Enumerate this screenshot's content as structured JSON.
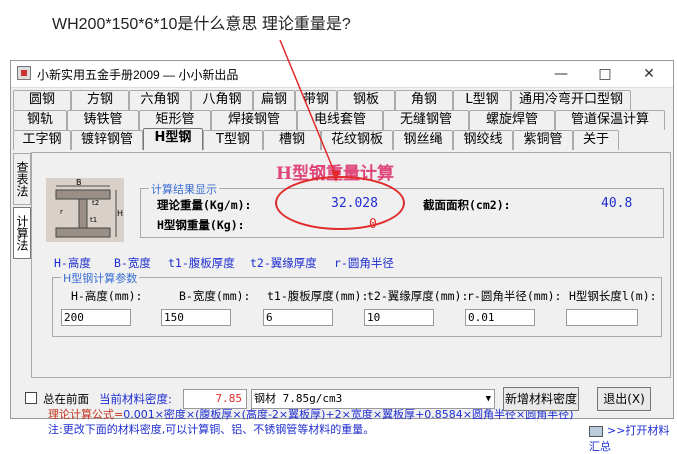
{
  "question": {
    "text": "WH200*150*6*10是什么意思 理论重量是?"
  },
  "window": {
    "title": "小新实用五金手册2009 — 小小新出品",
    "minimize": "—",
    "maximize": "□",
    "close": "✕"
  },
  "tabs": {
    "row1": [
      "圆钢",
      "方钢",
      "六角钢",
      "八角钢",
      "扁钢",
      "带钢",
      "钢板",
      "角钢",
      "L型钢",
      "通用冷弯开口型钢"
    ],
    "row2": [
      "钢轨",
      "铸铁管",
      "矩形管",
      "焊接钢管",
      "电线套管",
      "无缝钢管",
      "螺旋焊管",
      "管道保温计算"
    ],
    "row3": [
      "工字钢",
      "镀锌钢管",
      "H型钢",
      "T型钢",
      "槽钢",
      "花纹钢板",
      "钢丝绳",
      "钢绞线",
      "紫铜管",
      "关于"
    ],
    "active": "H型钢"
  },
  "vtabs": {
    "lookup": "查表法",
    "calc": "计算法"
  },
  "diagram": {
    "b": "B",
    "t2": "t2",
    "r": "r",
    "t1": "t1",
    "h": "H"
  },
  "main": {
    "title": "H型钢重量计算",
    "result_legend": "计算结果显示",
    "theory_weight_label": "理论重量(Kg/m):",
    "theory_weight_value": "32.028",
    "h_weight_label": "H型钢重量(Kg):",
    "h_weight_value": "0",
    "area_label": "截面面积(cm2):",
    "area_value": "40.8"
  },
  "keys": [
    "H-高度",
    "B-宽度",
    "t1-腹板厚度",
    "t2-翼缘厚度",
    "r-圆角半径"
  ],
  "params": {
    "legend": "H型钢计算参数",
    "fields": [
      {
        "label": "H-高度(mm):",
        "value": "200"
      },
      {
        "label": "B-宽度(mm):",
        "value": "150"
      },
      {
        "label": "t1-腹板厚度(mm):",
        "value": "6"
      },
      {
        "label": "t2-翼缘厚度(mm):",
        "value": "10"
      },
      {
        "label": "r-圆角半径(mm):",
        "value": "0.01"
      },
      {
        "label": "H型钢长度l(m):",
        "value": ""
      }
    ]
  },
  "formula": {
    "prefix": "理论计算公式=",
    "body": "0.001×密度×(腹板厚×(高度-2×翼板厚)+2×宽度×翼板厚+0.8584×圆角半径×圆角半径)"
  },
  "note": "注:更改下面的材料密度,可以计算铜、铝、不锈钢管等材料的重量。",
  "link": ">>打开材料汇总",
  "bottom": {
    "ontop": "总在前面",
    "density_label": "当前材料密度:",
    "density_value": "7.85",
    "material": "钢材 7.85g/cm3",
    "add_material": "新增材料密度",
    "exit": "退出(X)"
  }
}
